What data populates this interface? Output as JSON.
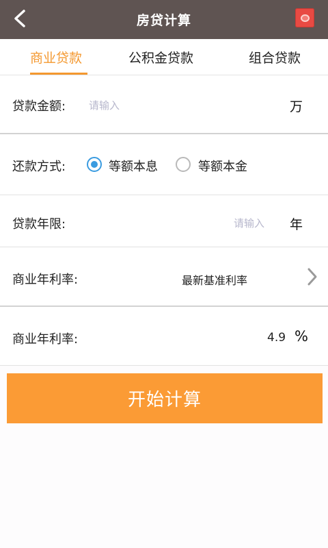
{
  "header": {
    "title": "房贷计算"
  },
  "tabs": [
    {
      "label": "商业贷款",
      "active": true
    },
    {
      "label": "公积金贷款",
      "active": false
    },
    {
      "label": "组合贷款",
      "active": false
    }
  ],
  "form": {
    "amount": {
      "label": "贷款金额:",
      "placeholder": "请输入",
      "unit": "万"
    },
    "repayment": {
      "label": "还款方式:",
      "options": [
        {
          "label": "等额本息",
          "selected": true
        },
        {
          "label": "等额本金",
          "selected": false
        }
      ]
    },
    "term": {
      "label": "贷款年限:",
      "placeholder": "请输入",
      "unit": "年"
    },
    "rate_type": {
      "label": "商业年利率:",
      "value": "最新基准利率"
    },
    "rate": {
      "label": "商业年利率:",
      "value": "4.9",
      "unit": "%"
    }
  },
  "actions": {
    "calculate_label": "开始计算"
  },
  "colors": {
    "header_bg": "#5f5452",
    "accent": "#f4982f",
    "button_bg": "#fb9b35",
    "radio_selected": "#3a9be0"
  }
}
